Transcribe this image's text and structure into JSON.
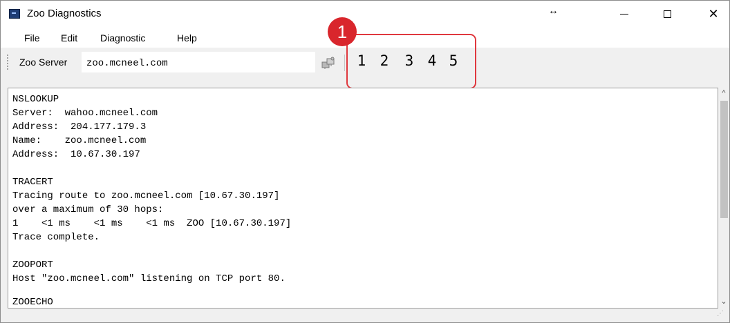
{
  "window": {
    "title": "Zoo Diagnostics",
    "resize_glyph": "↔",
    "close_glyph": "✕"
  },
  "menu": {
    "items": [
      "File",
      "Edit",
      "Diagnostic",
      "Help"
    ]
  },
  "toolbar": {
    "server_label": "Zoo Server",
    "server_value": "zoo.mcneel.com",
    "numbers": [
      "1",
      "2",
      "3",
      "4",
      "5"
    ]
  },
  "callout": {
    "number": "1",
    "color": "#d9262c"
  },
  "output": {
    "lines": [
      "NSLOOKUP",
      "Server:  wahoo.mcneel.com",
      "Address:  204.177.179.3",
      "Name:    zoo.mcneel.com",
      "Address:  10.67.30.197",
      "",
      "TRACERT",
      "Tracing route to zoo.mcneel.com [10.67.30.197]",
      "over a maximum of 30 hops:",
      "1    <1 ms    <1 ms    <1 ms  ZOO [10.67.30.197]",
      "Trace complete.",
      "",
      "ZOOPORT",
      "Host \"zoo.mcneel.com\" listening on TCP port 80.",
      "",
      "ZOOECHO"
    ]
  },
  "colors": {
    "accent_red": "#e0383e",
    "titlebar_icon": "#1f3d74"
  }
}
